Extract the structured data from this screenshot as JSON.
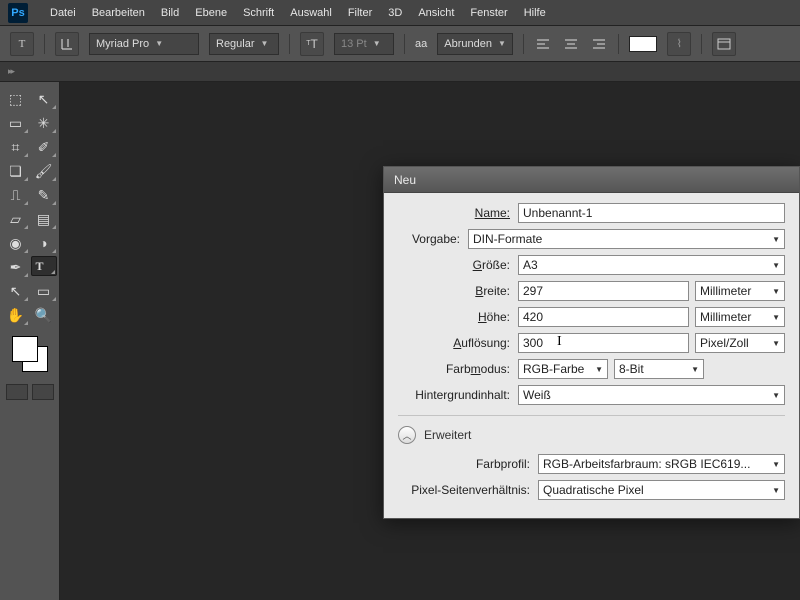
{
  "app": {
    "logo": "Ps"
  },
  "menu": [
    "Datei",
    "Bearbeiten",
    "Bild",
    "Ebene",
    "Schrift",
    "Auswahl",
    "Filter",
    "3D",
    "Ansicht",
    "Fenster",
    "Hilfe"
  ],
  "optbar": {
    "tool_glyph": "T",
    "font_family": "Myriad Pro",
    "font_style": "Regular",
    "size_label": "13 Pt",
    "aa_glyph": "aa",
    "aa_mode": "Abrunden"
  },
  "tools": [
    {
      "glyph": "⬚",
      "name": "move"
    },
    {
      "glyph": "↖",
      "name": "move-arrow"
    },
    {
      "glyph": "▭",
      "name": "marquee"
    },
    {
      "glyph": "✳",
      "name": "magic-wand"
    },
    {
      "glyph": "✂",
      "name": "crop"
    },
    {
      "glyph": "✎",
      "name": "eyedropper"
    },
    {
      "glyph": "❑",
      "name": "patch"
    },
    {
      "glyph": "🖌",
      "name": "brush"
    },
    {
      "glyph": "▲",
      "name": "stamp"
    },
    {
      "glyph": "✐",
      "name": "history-brush"
    },
    {
      "glyph": "▦",
      "name": "eraser"
    },
    {
      "glyph": "▤",
      "name": "gradient"
    },
    {
      "glyph": "◌",
      "name": "blur"
    },
    {
      "glyph": "◑",
      "name": "dodge"
    },
    {
      "glyph": "✒",
      "name": "pen"
    },
    {
      "glyph": "T",
      "name": "type",
      "selected": true
    },
    {
      "glyph": "↖",
      "name": "path-sel"
    },
    {
      "glyph": "▭",
      "name": "shape"
    },
    {
      "glyph": "✋",
      "name": "hand"
    },
    {
      "glyph": "🔍",
      "name": "zoom"
    }
  ],
  "dialog": {
    "title": "Neu",
    "name_label": "Name:",
    "name_value": "Unbenannt-1",
    "preset_label": "Vorgabe:",
    "preset_value": "DIN-Formate",
    "size_label": "Größe:",
    "size_letter": "G",
    "size_value": "A3",
    "width_label": "Breite:",
    "width_letter": "B",
    "width_value": "297",
    "width_unit": "Millimeter",
    "height_label": "Höhe:",
    "height_letter": "H",
    "height_value": "420",
    "height_unit": "Millimeter",
    "res_label": "Auflösung:",
    "res_letter": "A",
    "res_value": "300",
    "res_unit": "Pixel/Zoll",
    "mode_label": "Farbmodus:",
    "mode_letter": "M",
    "mode_value": "RGB-Farbe",
    "depth_value": "8-Bit",
    "bg_label": "Hintergrundinhalt:",
    "bg_value": "Weiß",
    "advanced": "Erweitert",
    "profile_label": "Farbprofil:",
    "profile_value": "RGB-Arbeitsfarbraum:  sRGB IEC619...",
    "par_label": "Pixel-Seitenverhältnis:",
    "par_value": "Quadratische Pixel"
  }
}
